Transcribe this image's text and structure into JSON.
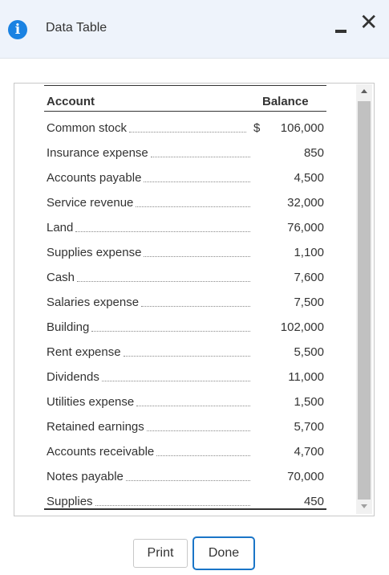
{
  "dialog": {
    "title": "Data Table"
  },
  "table": {
    "headers": {
      "account": "Account",
      "balance": "Balance"
    },
    "currency_symbol": "$",
    "rows": [
      {
        "account": "Common stock",
        "balance": "106,000"
      },
      {
        "account": "Insurance expense",
        "balance": "850"
      },
      {
        "account": "Accounts payable",
        "balance": "4,500"
      },
      {
        "account": "Service revenue",
        "balance": "32,000"
      },
      {
        "account": "Land",
        "balance": "76,000"
      },
      {
        "account": "Supplies expense",
        "balance": "1,100"
      },
      {
        "account": "Cash",
        "balance": "7,600"
      },
      {
        "account": "Salaries expense",
        "balance": "7,500"
      },
      {
        "account": "Building",
        "balance": "102,000"
      },
      {
        "account": "Rent expense",
        "balance": "5,500"
      },
      {
        "account": "Dividends",
        "balance": "11,000"
      },
      {
        "account": "Utilities expense",
        "balance": "1,500"
      },
      {
        "account": "Retained earnings",
        "balance": "5,700"
      },
      {
        "account": "Accounts receivable",
        "balance": "4,700"
      },
      {
        "account": "Notes payable",
        "balance": "70,000"
      },
      {
        "account": "Supplies",
        "balance": "450"
      }
    ]
  },
  "buttons": {
    "print": "Print",
    "done": "Done"
  },
  "colors": {
    "accent": "#1a82e2",
    "header_bg": "#eef3fb"
  }
}
